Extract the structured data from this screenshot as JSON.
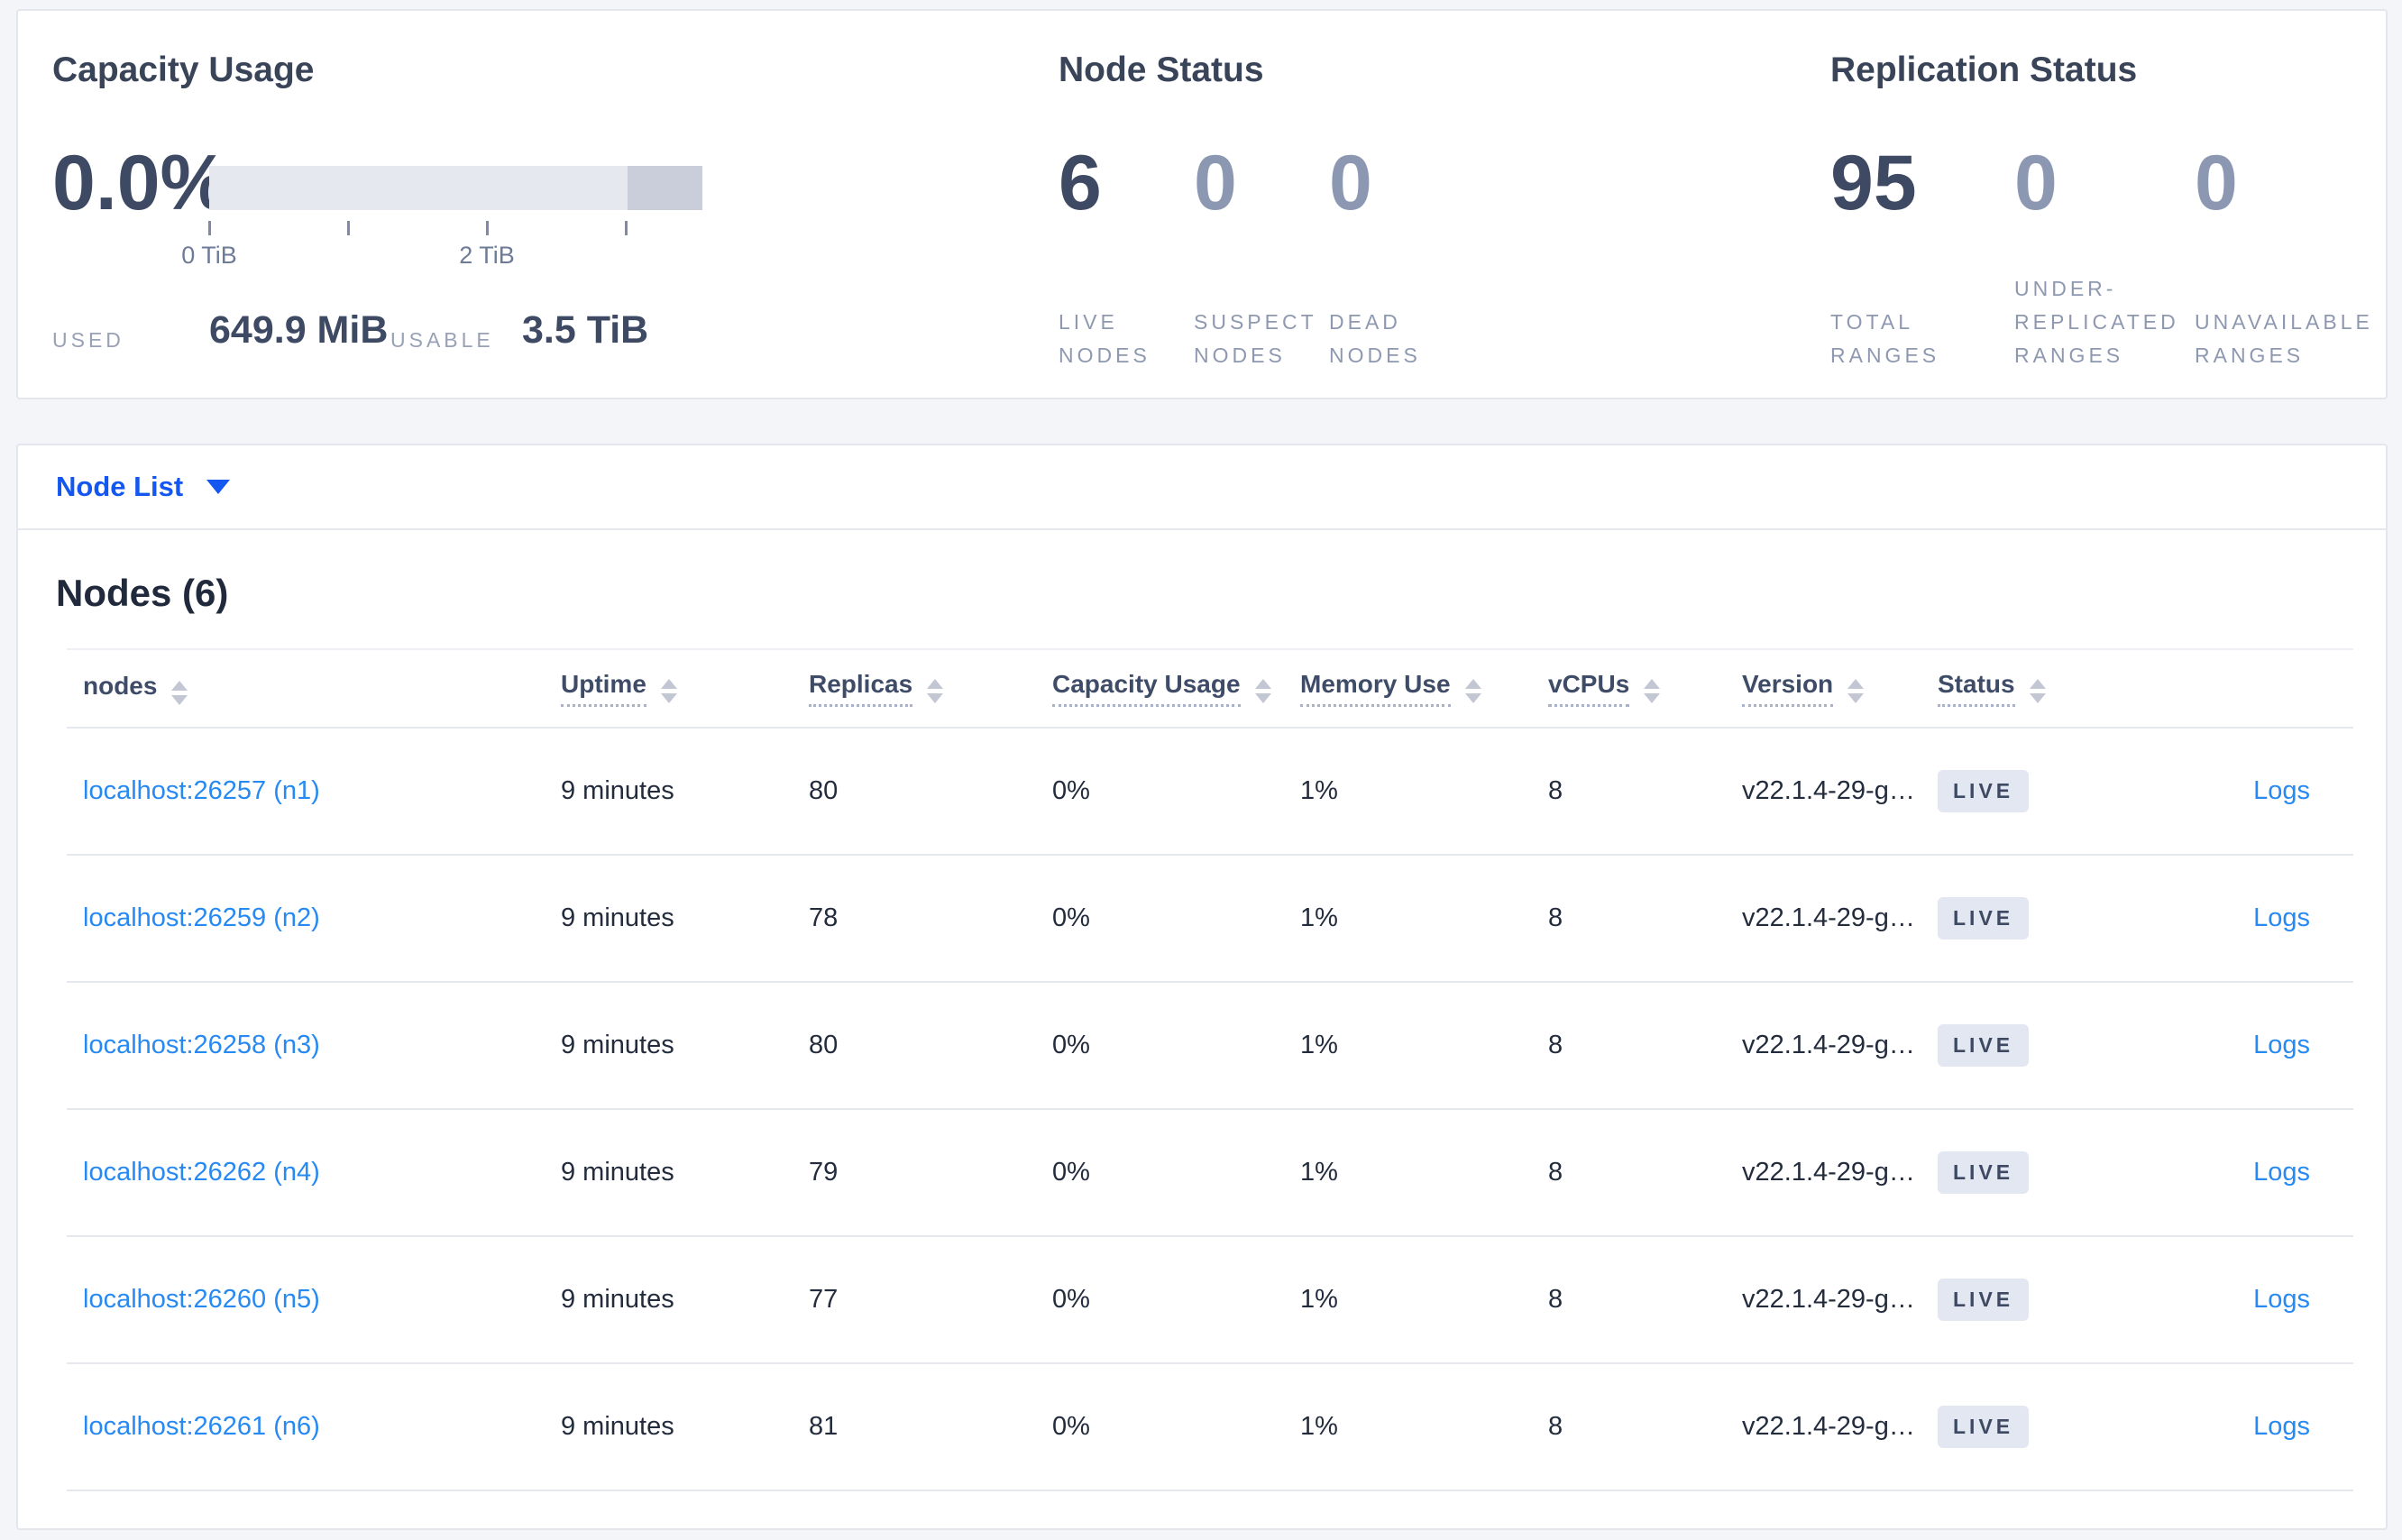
{
  "summary": {
    "capacity": {
      "title": "Capacity Usage",
      "percent": "0.0%",
      "tick_labels": [
        "0 TiB",
        "2 TiB"
      ],
      "used_label": "USED",
      "used_value": "649.9 MiB",
      "usable_label": "USABLE",
      "usable_value": "3.5 TiB"
    },
    "node_status": {
      "title": "Node Status",
      "stats": [
        {
          "value": "6",
          "label": "LIVE NODES"
        },
        {
          "value": "0",
          "label": "SUSPECT NODES"
        },
        {
          "value": "0",
          "label": "DEAD NODES"
        }
      ]
    },
    "replication": {
      "title": "Replication Status",
      "stats": [
        {
          "value": "95",
          "label": "TOTAL RANGES"
        },
        {
          "value": "0",
          "label": "UNDER-REPLICATED RANGES"
        },
        {
          "value": "0",
          "label": "UNAVAILABLE RANGES"
        }
      ]
    }
  },
  "view_selector": {
    "label": "Node List",
    "icon": "caret-down-icon"
  },
  "nodes_section": {
    "title": "Nodes (6)",
    "columns": [
      {
        "label": "nodes"
      },
      {
        "label": "Uptime"
      },
      {
        "label": "Replicas"
      },
      {
        "label": "Capacity Usage"
      },
      {
        "label": "Memory Use"
      },
      {
        "label": "vCPUs"
      },
      {
        "label": "Version"
      },
      {
        "label": "Status"
      }
    ],
    "rows": [
      {
        "address": "localhost:26257 (n1)",
        "uptime": "9 minutes",
        "replicas": "80",
        "capacity_usage": "0%",
        "memory_use": "1%",
        "vcpus": "8",
        "version": "v22.1.4-29-g…",
        "status": "LIVE",
        "logs": "Logs"
      },
      {
        "address": "localhost:26259 (n2)",
        "uptime": "9 minutes",
        "replicas": "78",
        "capacity_usage": "0%",
        "memory_use": "1%",
        "vcpus": "8",
        "version": "v22.1.4-29-g…",
        "status": "LIVE",
        "logs": "Logs"
      },
      {
        "address": "localhost:26258 (n3)",
        "uptime": "9 minutes",
        "replicas": "80",
        "capacity_usage": "0%",
        "memory_use": "1%",
        "vcpus": "8",
        "version": "v22.1.4-29-g…",
        "status": "LIVE",
        "logs": "Logs"
      },
      {
        "address": "localhost:26262 (n4)",
        "uptime": "9 minutes",
        "replicas": "79",
        "capacity_usage": "0%",
        "memory_use": "1%",
        "vcpus": "8",
        "version": "v22.1.4-29-g…",
        "status": "LIVE",
        "logs": "Logs"
      },
      {
        "address": "localhost:26260 (n5)",
        "uptime": "9 minutes",
        "replicas": "77",
        "capacity_usage": "0%",
        "memory_use": "1%",
        "vcpus": "8",
        "version": "v22.1.4-29-g…",
        "status": "LIVE",
        "logs": "Logs"
      },
      {
        "address": "localhost:26261 (n6)",
        "uptime": "9 minutes",
        "replicas": "81",
        "capacity_usage": "0%",
        "memory_use": "1%",
        "vcpus": "8",
        "version": "v22.1.4-29-g…",
        "status": "LIVE",
        "logs": "Logs"
      }
    ]
  },
  "colors": {
    "page_background": "#f4f5f9",
    "card_background": "#ffffff",
    "card_border": "#e3e6ed",
    "heading_text": "#3a4459",
    "stat_number": "#3e4a63",
    "stat_number_muted": "#8c97b2",
    "stat_label": "#8e98b0",
    "bar_track": "#e6e8ef",
    "bar_nonusable": "#c9ceda",
    "row_divider": "#e6e8f0",
    "link_blue": "#2789f2",
    "selector_blue": "#1457f0",
    "badge_background": "#e3e7f1",
    "badge_text": "#3e4a63"
  }
}
